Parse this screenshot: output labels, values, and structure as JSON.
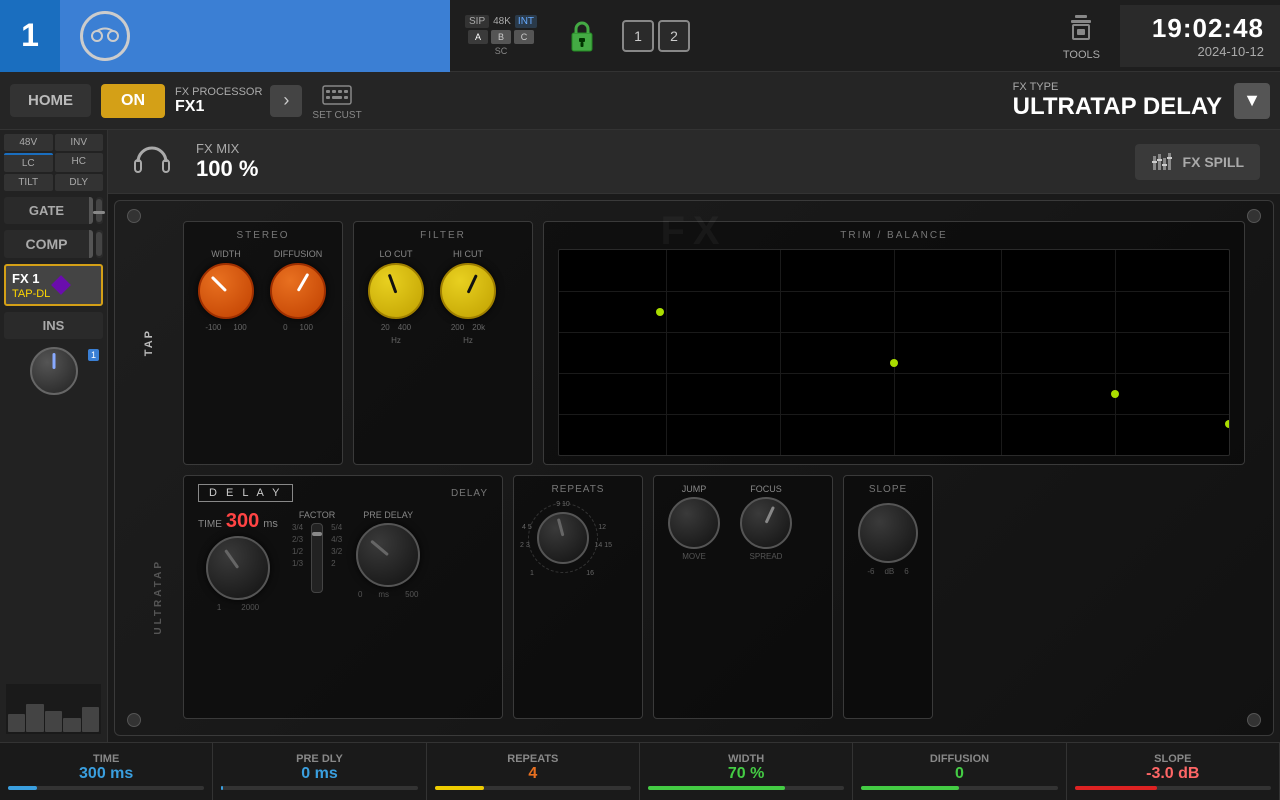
{
  "top_bar": {
    "channel_num": "1",
    "sip_label": "SIP",
    "sample_rate": "48K",
    "int_label": "INT",
    "badge_a": "A",
    "badge_b": "B",
    "badge_c": "C",
    "sc_label": "SC",
    "num1": "1",
    "num2": "2",
    "tools_label": "TOOLS",
    "clock_time": "19:02:48",
    "clock_date": "2024-10-12"
  },
  "nav_bar": {
    "home_label": "HOME",
    "on_label": "ON",
    "fx_processor_title": "FX PROCESSOR",
    "fx_processor_name": "FX1",
    "set_cust_label": "SET CUST",
    "fx_type_label": "FX TYPE",
    "fx_type_name": "ULTRATAP DELAY"
  },
  "fx_mix": {
    "label": "FX MIX",
    "value": "100 %",
    "spill_label": "FX SPILL"
  },
  "side_panel": {
    "btn_48v": "48V",
    "btn_inv": "INV",
    "btn_lc": "LC",
    "btn_hc": "HC",
    "btn_tilt": "TILT",
    "btn_dly": "DLY",
    "gate_label": "GATE",
    "comp_label": "COMP",
    "fx1_label": "FX 1",
    "fx1_sub": "TAP-DL",
    "ins_label": "INS"
  },
  "plugin": {
    "title_bg": "FX",
    "tap_label": "TAP",
    "delay_label_vert": "ULTRATAP",
    "delay_box": "D E L A Y",
    "stereo_section": {
      "title": "STEREO",
      "width_label": "WIDTH",
      "width_min": "-100",
      "width_max": "100",
      "diffusion_label": "DIFFUSION",
      "diffusion_min": "0",
      "diffusion_max": "100"
    },
    "filter_section": {
      "title": "FILTER",
      "locut_label": "LO CUT",
      "locut_min": "20",
      "locut_max": "400",
      "locut_unit": "Hz",
      "hicut_label": "HI CUT",
      "hicut_min": "200",
      "hicut_max": "20k",
      "hicut_unit": "Hz"
    },
    "delay_section": {
      "title": "DELAY",
      "time_label": "TIME",
      "time_value": "300",
      "time_unit": "ms",
      "time_min": "1",
      "time_max": "2000",
      "factor_label": "FACTOR",
      "factor_vals": [
        "3/4",
        "2/3",
        "1/2",
        "1/3",
        "5/4",
        "4/3",
        "3/2",
        "2"
      ],
      "predelay_label": "PRE DELAY",
      "predelay_min": "0",
      "predelay_max": "500",
      "predelay_unit": "ms"
    },
    "trim_section": {
      "title": "TRIM / BALANCE"
    },
    "repeats_section": {
      "label": "REPEATS",
      "min": "1",
      "max": "16"
    },
    "jump_label": "JUMP",
    "move_label": "MOVE",
    "focus_label": "FOCUS",
    "spread_label": "SPREAD",
    "slope_label": "SLOPE",
    "slope_min": "-6",
    "slope_unit": "dB",
    "slope_max": "6"
  },
  "bottom_bar": {
    "time_label": "TIME",
    "time_value": "300 ms",
    "predly_label": "PRE DLY",
    "predly_value": "0 ms",
    "repeats_label": "REPEATS",
    "repeats_value": "4",
    "width_label": "WIDTH",
    "width_value": "70 %",
    "diffusion_label": "DIFFUSION",
    "diffusion_value": "0",
    "slope_label": "SLOPE",
    "slope_value": "-3.0 dB"
  }
}
